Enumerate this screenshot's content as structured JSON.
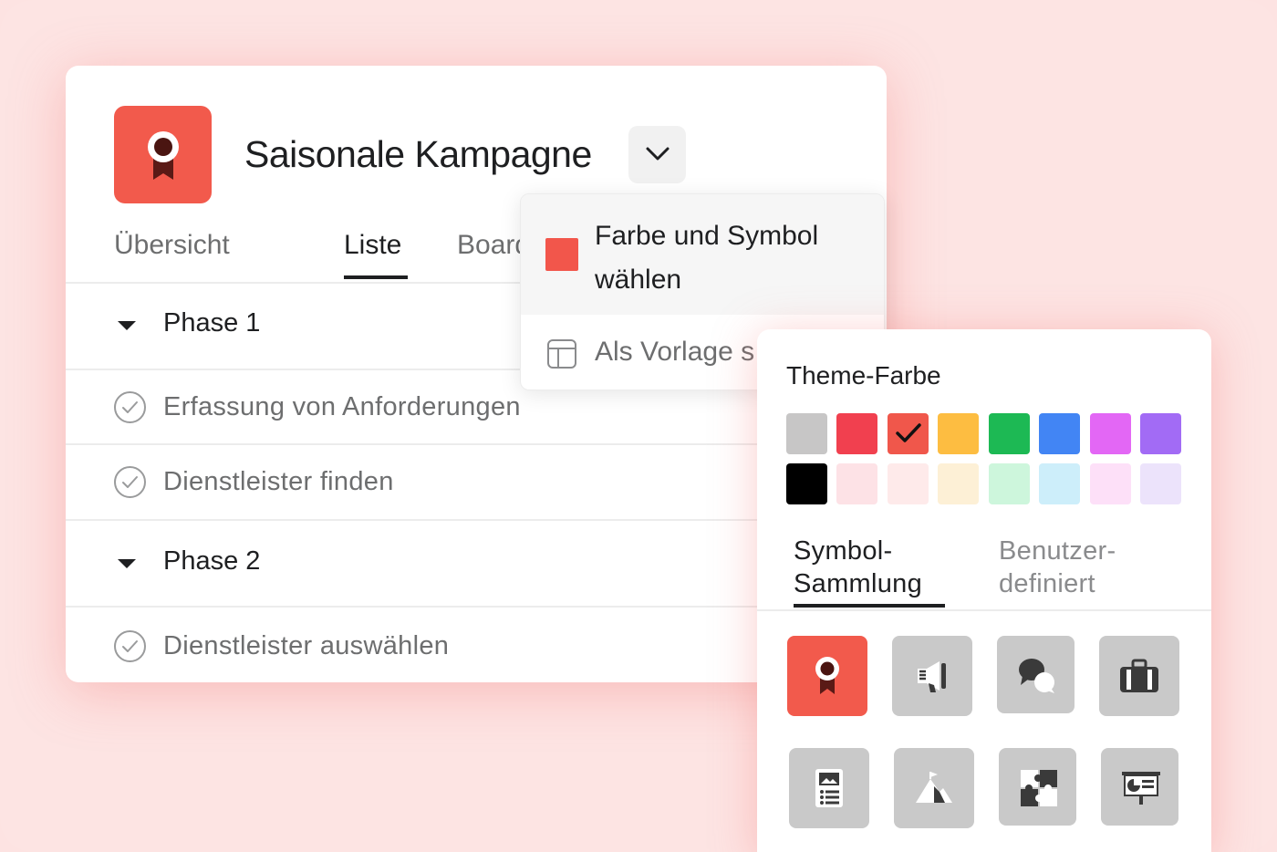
{
  "project": {
    "title": "Saisonale Kampagne",
    "icon": "ribbon-award-icon",
    "color": "#f25a4c"
  },
  "tabs": [
    {
      "label": "Übersicht",
      "active": false
    },
    {
      "label": "Liste",
      "active": true
    },
    {
      "label": "Board",
      "active": false
    }
  ],
  "list": {
    "sections": [
      {
        "label": "Phase 1",
        "tasks": [
          "Erfassung von Anforderungen",
          "Dienstleister finden"
        ]
      },
      {
        "label": "Phase 2",
        "tasks": [
          "Dienstleister auswählen"
        ]
      }
    ]
  },
  "menu": {
    "item_color_label": "Farbe und Symbol wählen",
    "item_color_swatch": "#f2564b",
    "item_template_label": "Als Vorlage s"
  },
  "picker": {
    "title": "Theme-Farbe",
    "selected_color": "#f0574b",
    "colors_row1": [
      "#c7c6c6",
      "#f1404f",
      "#f0574b",
      "#fdbd41",
      "#1db954",
      "#4285f4",
      "#e367f5",
      "#a26bf5"
    ],
    "colors_row2": [
      "#000000",
      "#fde2e6",
      "#feeaea",
      "#fdf0d6",
      "#cdf6dc",
      "#cdeefa",
      "#fde0f8",
      "#ece3fb"
    ],
    "tab_collection": "Symbol-\nSammlung",
    "tab_custom": "Benutzer-\ndefiniert",
    "icons": [
      "ribbon-award-icon",
      "megaphone-icon",
      "chat-bubbles-icon",
      "briefcase-icon",
      "document-image-icon",
      "mountain-flag-icon",
      "puzzle-icon",
      "presentation-board-icon"
    ]
  }
}
